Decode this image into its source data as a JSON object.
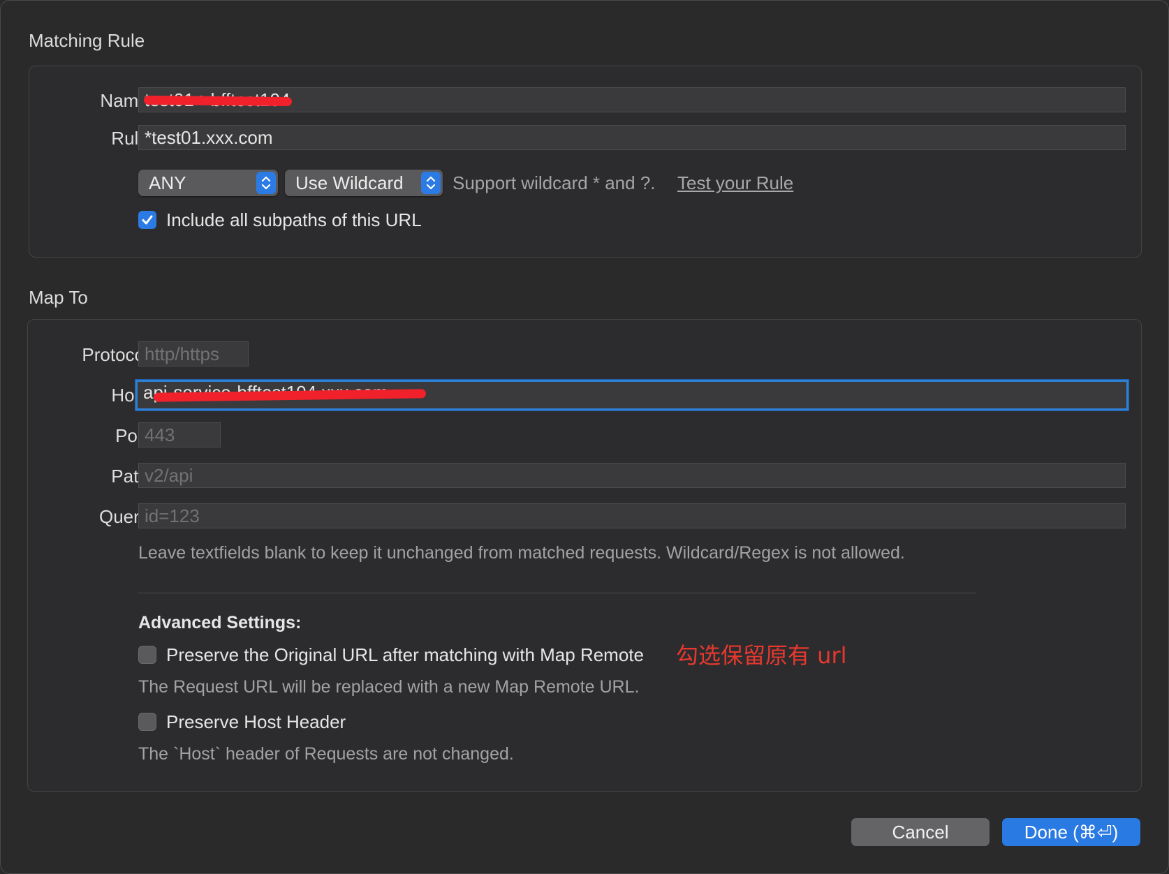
{
  "matching_rule": {
    "title": "Matching Rule",
    "name_label": "Name:",
    "name_value": "test01->bfftest104",
    "rule_label": "Rule:",
    "rule_value": "*test01.xxx.com",
    "method_select": "ANY",
    "match_type_select": "Use Wildcard",
    "wildcard_hint": "Support wildcard * and ?.",
    "test_rule_link": "Test your Rule",
    "include_subpaths_label": "Include all subpaths of this URL",
    "include_subpaths_checked": true
  },
  "map_to": {
    "title": "Map To",
    "protocol_label": "Protocol:",
    "protocol_placeholder": "http/https",
    "host_label": "Host:",
    "host_value": "api-service-bfftest104.xxx.com",
    "port_label": "Port:",
    "port_placeholder": "443",
    "path_label": "Path:",
    "path_placeholder": "v2/api",
    "query_label": "Query:",
    "query_placeholder": "id=123",
    "blank_hint": "Leave textfields blank to keep it unchanged from matched requests. Wildcard/Regex is not allowed."
  },
  "advanced": {
    "title": "Advanced Settings:",
    "preserve_url_label": "Preserve the Original URL after matching with Map Remote",
    "preserve_url_checked": false,
    "preserve_url_desc": "The Request URL will be replaced with a new Map Remote URL.",
    "preserve_host_label": "Preserve Host Header",
    "preserve_host_checked": false,
    "preserve_host_desc": "The `Host` header of Requests are not changed.",
    "annotation": "勾选保留原有 url"
  },
  "buttons": {
    "cancel": "Cancel",
    "done": "Done (⌘⏎)"
  },
  "colors": {
    "accent": "#2a7ae3",
    "redaction": "#f0212b",
    "annotation": "#e8382e"
  }
}
